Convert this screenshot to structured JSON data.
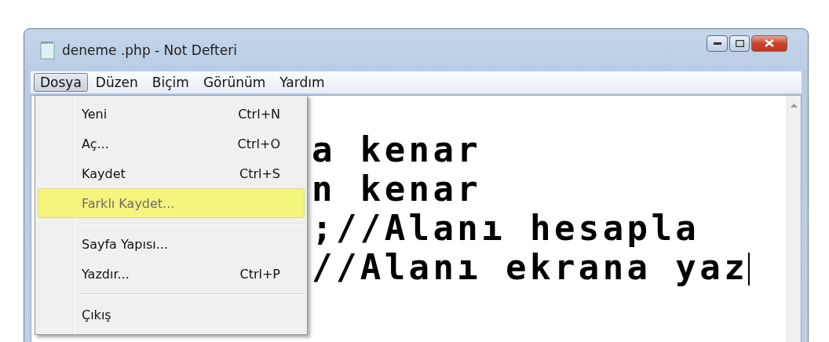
{
  "window": {
    "title": "deneme .php - Not Defteri"
  },
  "menu_bar": [
    {
      "label": "Dosya",
      "selected": true
    },
    {
      "label": "Düzen",
      "selected": false
    },
    {
      "label": "Biçim",
      "selected": false
    },
    {
      "label": "Görünüm",
      "selected": false
    },
    {
      "label": "Yardım",
      "selected": false
    }
  ],
  "file_menu": [
    {
      "kind": "item",
      "label": "Yeni",
      "shortcut": "Ctrl+N",
      "selected": false
    },
    {
      "kind": "item",
      "label": "Aç...",
      "shortcut": "Ctrl+O",
      "selected": false
    },
    {
      "kind": "item",
      "label": "Kaydet",
      "shortcut": "Ctrl+S",
      "selected": false
    },
    {
      "kind": "item",
      "label": "Farklı Kaydet...",
      "selected": true
    },
    {
      "kind": "separator"
    },
    {
      "kind": "item",
      "label": "Sayfa Yapısı...",
      "selected": false
    },
    {
      "kind": "item",
      "label": "Yazdır...",
      "shortcut": "Ctrl+P",
      "selected": false
    },
    {
      "kind": "separator"
    },
    {
      "kind": "item",
      "label": "Çıkış",
      "selected": false
    }
  ],
  "editor": {
    "lines": [
      "a kenar",
      "n kenar",
      ";//Alanı hesapla",
      "//Alanı ekrana yaz"
    ]
  }
}
